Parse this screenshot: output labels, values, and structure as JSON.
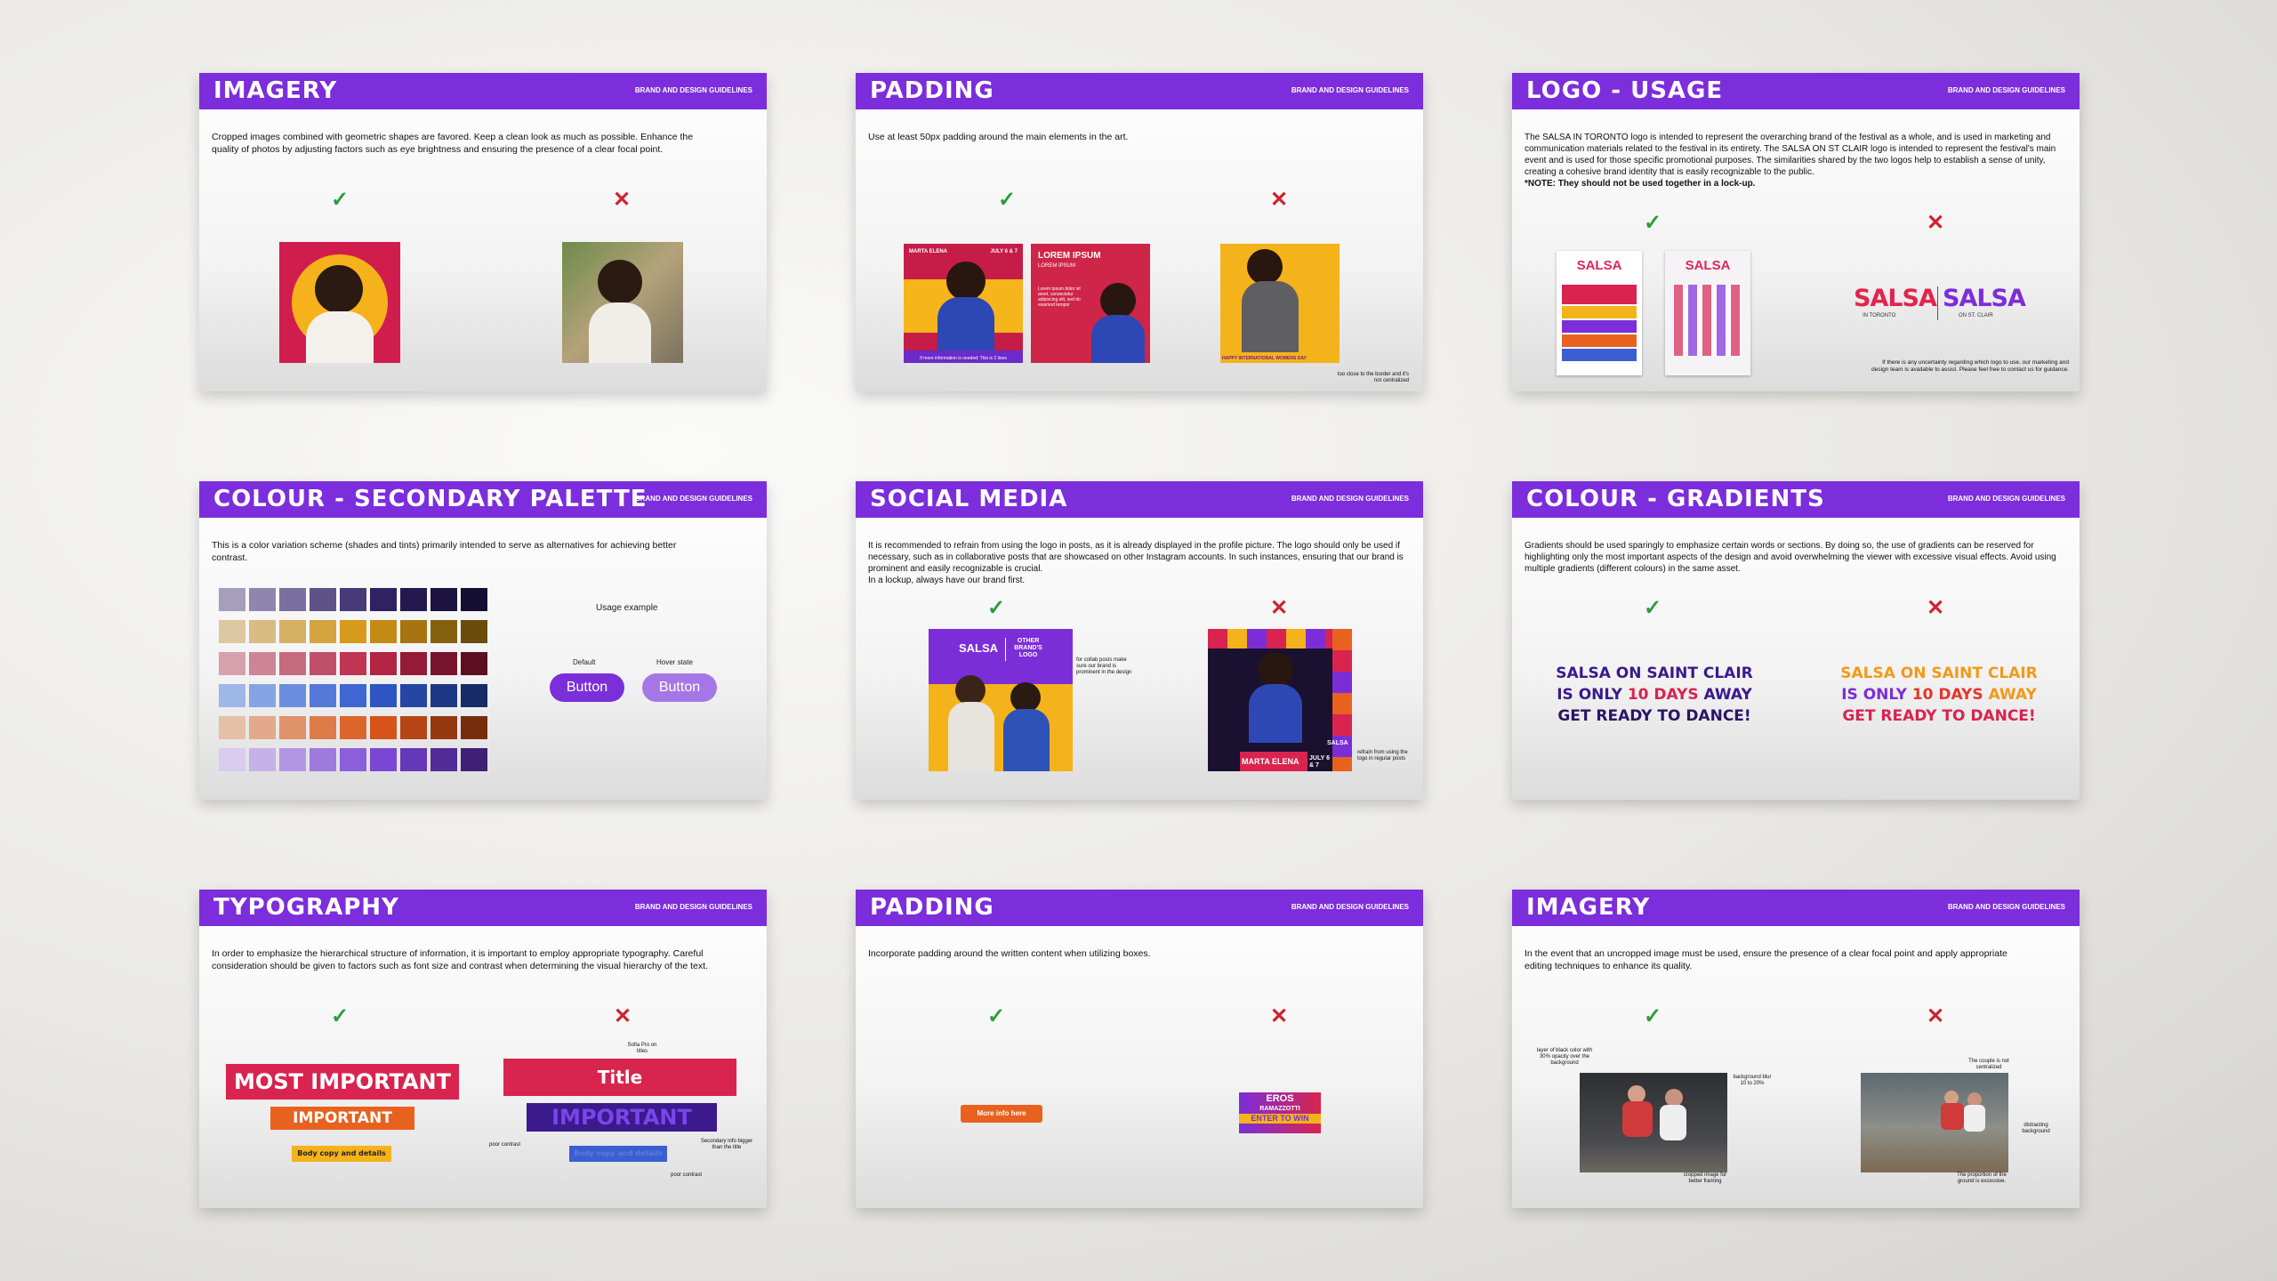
{
  "brand_tag": "BRAND AND DESIGN GUIDELINES",
  "check_glyph": "✓",
  "cross_glyph": "✕",
  "slides": {
    "imagery1": {
      "title": "IMAGERY",
      "desc": "Cropped images combined with geometric shapes are favored. Keep a clean look as much as possible. Enhance the quality of photos by adjusting factors such as eye brightness and ensuring the presence of a clear focal point."
    },
    "padding1": {
      "title": "PADDING",
      "desc": "Use at least 50px padding around the main elements in the art.",
      "poster1_name": "MARTA ELENA",
      "poster1_date": "JULY 6 & 7",
      "poster1_footer": "If more information is needed: This is 2 lines",
      "poster2_title": "LOREM IPSUM",
      "poster2_sub": "LOREM IPSUM",
      "poster2_body": "Lorem ipsum dolor sit amet, consectetur adipiscing elit, sed do eiusmod tempor",
      "poster3_footer": "HAPPY INTERNATIONAL WOMENS DAY",
      "note": "too close to the border and it's not centralized"
    },
    "logo": {
      "title": "LOGO - USAGE",
      "desc": "The SALSA IN TORONTO logo is intended to represent the overarching brand of the festival as a whole, and is used in marketing and communication materials related to the festival in its entirety. The SALSA ON ST CLAIR logo is intended to represent the festival's main event and is used for those specific promotional purposes. The similarities shared by the two logos help to establish a sense of unity, creating a cohesive brand identity that is easily recognizable to the public.",
      "desc_note": "*NOTE: They should not be used together in a lock-up.",
      "logo_word": "SALSA",
      "logo_sub1": "IN TORONTO",
      "logo_sub2": "ON ST. CLAIR",
      "note": "If there is any uncertainty regarding which logo to use, our marketing and design team is available to assist. Please feel free to contact us for guidance."
    },
    "palette": {
      "title": "COLOUR - SECONDARY PALETTE",
      "desc": "This is a color variation scheme (shades and tints) primarily intended to serve as alternatives for achieving better contrast.",
      "usage_label": "Usage example",
      "default_label": "Default",
      "hover_label": "Hover state",
      "button_label": "Button",
      "rows": [
        [
          "#a59ebd",
          "#8f86ad",
          "#7a6f9e",
          "#5e5289",
          "#473a78",
          "#2f2260",
          "#24194f",
          "#1c1340",
          "#150e33"
        ],
        [
          "#dcc7a0",
          "#d8bc83",
          "#d5b062",
          "#d3a440",
          "#d69a1c",
          "#c58a14",
          "#a67410",
          "#85600e",
          "#6a4c0b"
        ],
        [
          "#d6a0ad",
          "#ce8496",
          "#c66a80",
          "#bf506b",
          "#bf3553",
          "#b22344",
          "#951a38",
          "#78142d",
          "#5d0f22"
        ],
        [
          "#9fb6e8",
          "#86a3e3",
          "#6c8ede",
          "#5479d8",
          "#3f66d2",
          "#2f55c4",
          "#2646a4",
          "#1e3885",
          "#172b66"
        ],
        [
          "#e5bfa8",
          "#e2a98a",
          "#e0926a",
          "#de7b4b",
          "#dc652c",
          "#d6531a",
          "#b64515",
          "#953810",
          "#772c0c"
        ],
        [
          "#d8cdef",
          "#c5b2ea",
          "#b296e4",
          "#9e7adf",
          "#8b5fda",
          "#7a47d4",
          "#6637b8",
          "#522b96",
          "#3f2074"
        ]
      ],
      "btn_default_color": "#7b2fd9",
      "btn_hover_color": "#a577e6"
    },
    "social": {
      "title": "SOCIAL MEDIA",
      "desc": "It is recommended to refrain from using the logo in posts, as it is already displayed in the profile picture. The logo should only be used if necessary, such as in collaborative posts that are showcased on other Instagram accounts. In such instances, ensuring that our brand is prominent and easily recognizable is crucial.\nIn a lockup, always have our brand first.",
      "post1_logo": "SALSA",
      "post1_other": "OTHER BRAND'S LOGO",
      "note1": "for collab posts make sure our brand is prominent in the design",
      "post2_name": "MARTA ELENA",
      "post2_date": "JULY 6 & 7",
      "post2_logo": "SALSA",
      "note2": "refrain from using the logo in regular posts"
    },
    "gradients": {
      "title": "COLOUR - GRADIENTS",
      "desc": "Gradients should be used sparingly to emphasize certain words or sections. By doing so, the use of gradients can be reserved for highlighting only the most important aspects of the design and avoid overwhelming the viewer with excessive visual effects. Avoid using multiple gradients (different colours) in the same asset.",
      "line1": "SALSA ON SAINT CLAIR",
      "line2a": "IS ONLY ",
      "line2b": "10 DAYS",
      "line2c": " AWAY",
      "line3": "GET READY TO DANCE!"
    },
    "typography": {
      "title": "TYPOGRAPHY",
      "desc": "In order to emphasize the hierarchical structure of information, it is important to employ appropriate typography. Careful consideration should be given to factors such as font size and contrast when determining the visual hierarchy of the text.",
      "most_important": "MOST IMPORTANT",
      "important": "IMPORTANT",
      "body_copy": "Body copy and details",
      "title_word": "Title",
      "note_font": "Sofia Pro on titles",
      "note_poor1": "poor contrast",
      "note_secondary": "Secondary info bigger than the title",
      "note_poor2": "poor contrast"
    },
    "padding2": {
      "title": "PADDING",
      "desc": "Incorporate padding around the written content when utilizing boxes.",
      "btn_label": "More info here",
      "eros1": "EROS",
      "eros2": "RAMAZZOTTI",
      "eros3": "ENTER TO WIN"
    },
    "imagery2": {
      "title": "IMAGERY",
      "desc": "In the event that an uncropped image must be used, ensure the presence of a clear focal point and apply appropriate editing techniques to enhance its quality.",
      "n_layer": "layer of black color with 30% opacity over the background",
      "n_blur": "background blur 10 to 20%",
      "n_crop": "cropped image for better framing",
      "n_couple": "The couple is not centralized",
      "n_distract": "distracting background",
      "n_ground": "The proportion of the ground is excessive."
    }
  }
}
